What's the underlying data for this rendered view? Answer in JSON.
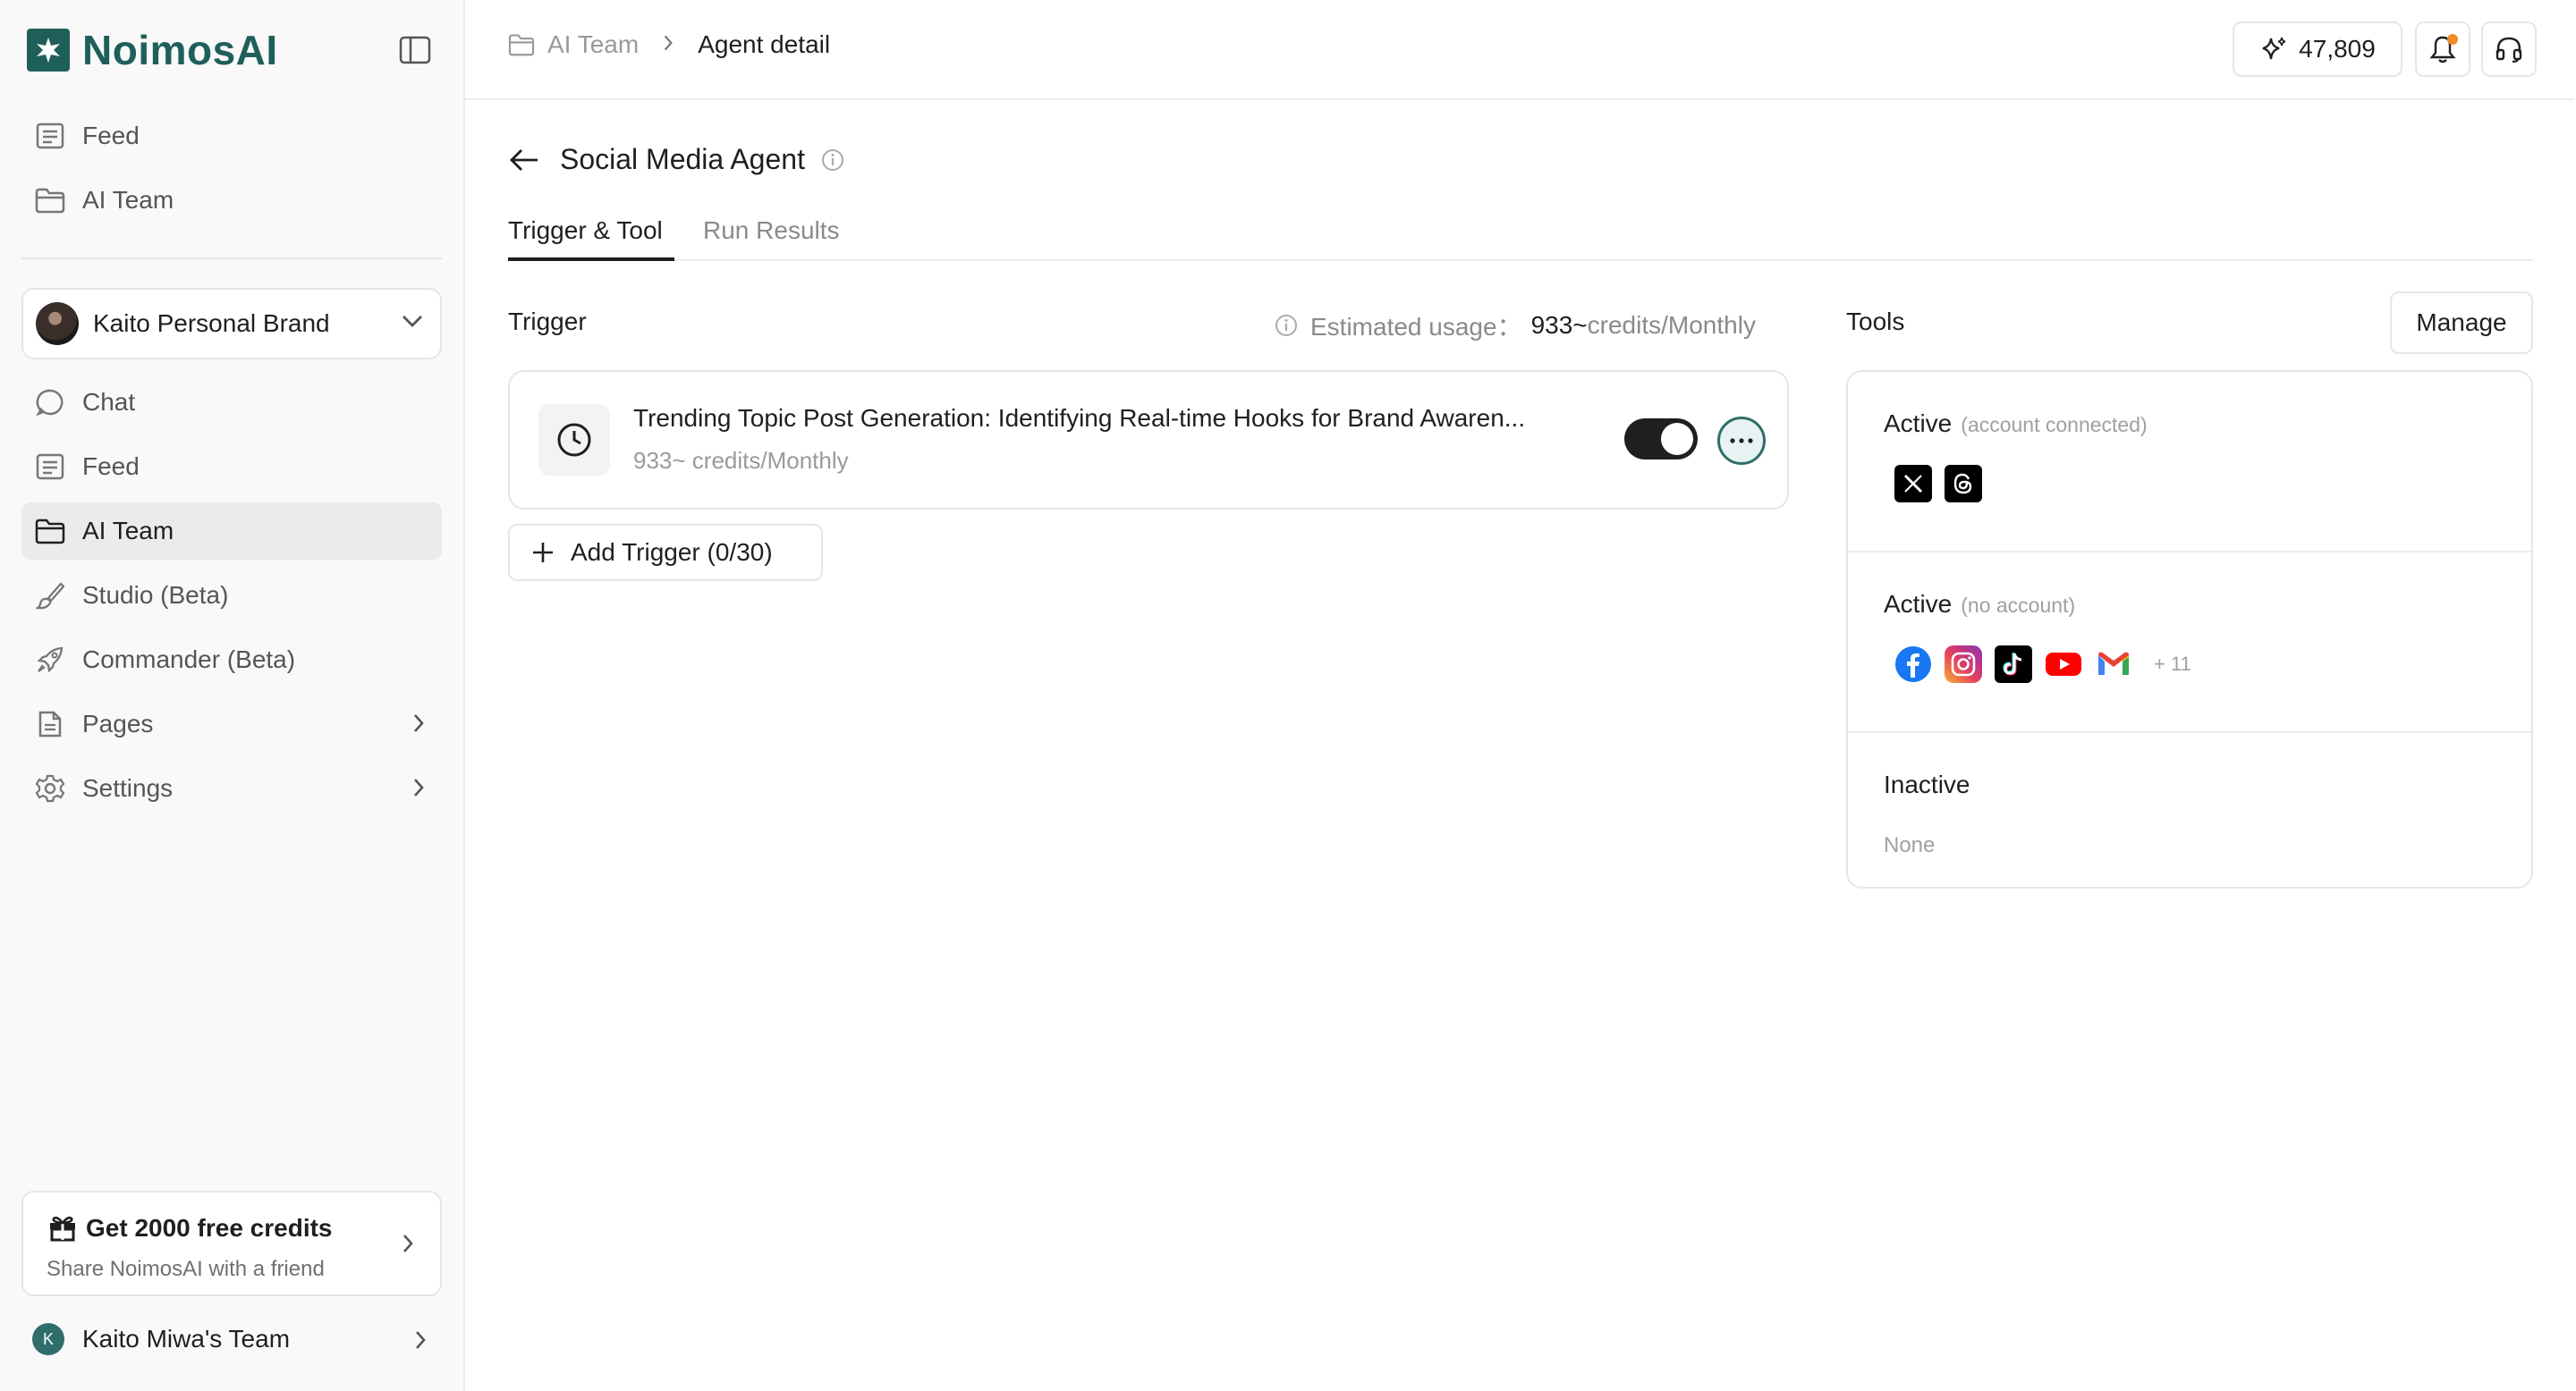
{
  "app": {
    "name": "NoimosAI",
    "brand_color": "#1f5f5b",
    "accent_color": "#2f6e6a"
  },
  "sidebar": {
    "top_items": [
      {
        "label": "Feed",
        "icon": "newspaper-icon"
      },
      {
        "label": "AI Team",
        "icon": "folder-icon"
      }
    ],
    "brand_selector": {
      "label": "Kaito Personal Brand"
    },
    "items": [
      {
        "label": "Chat",
        "icon": "chat-bubble-icon"
      },
      {
        "label": "Feed",
        "icon": "newspaper-icon"
      },
      {
        "label": "AI Team",
        "icon": "folder-icon",
        "active": true
      },
      {
        "label": "Studio (Beta)",
        "icon": "brush-icon"
      },
      {
        "label": "Commander (Beta)",
        "icon": "rocket-icon"
      },
      {
        "label": "Pages",
        "icon": "document-icon",
        "has_submenu": true
      },
      {
        "label": "Settings",
        "icon": "gear-icon",
        "has_submenu": true
      }
    ],
    "promo": {
      "title": "Get 2000 free credits",
      "subtitle": "Share NoimosAI with a friend"
    },
    "team": {
      "initial": "K",
      "name": "Kaito Miwa's Team"
    }
  },
  "header": {
    "breadcrumb": [
      "AI Team",
      "Agent detail"
    ],
    "credits": "47,809"
  },
  "page": {
    "title": "Social Media Agent",
    "tabs": [
      {
        "label": "Trigger & Tool",
        "active": true
      },
      {
        "label": "Run Results",
        "active": false
      }
    ]
  },
  "trigger": {
    "section_label": "Trigger",
    "usage_label": "Estimated usage：",
    "usage_value": "933~",
    "usage_unit": "credits/Monthly",
    "items": [
      {
        "title": "Trending Topic Post Generation: Identifying Real-time Hooks for Brand Awaren...",
        "subtitle": "933~ credits/Monthly",
        "enabled": true
      }
    ],
    "add_label": "Add Trigger (0/30)"
  },
  "tools": {
    "section_label": "Tools",
    "manage_label": "Manage",
    "groups": [
      {
        "title": "Active",
        "hint": "(account connected)",
        "icons": [
          "x-icon",
          "threads-icon"
        ]
      },
      {
        "title": "Active",
        "hint": "(no account)",
        "icons": [
          "facebook-icon",
          "instagram-icon",
          "tiktok-icon",
          "youtube-icon",
          "gmail-icon"
        ],
        "more": "+ 11"
      },
      {
        "title": "Inactive",
        "empty_text": "None"
      }
    ]
  }
}
